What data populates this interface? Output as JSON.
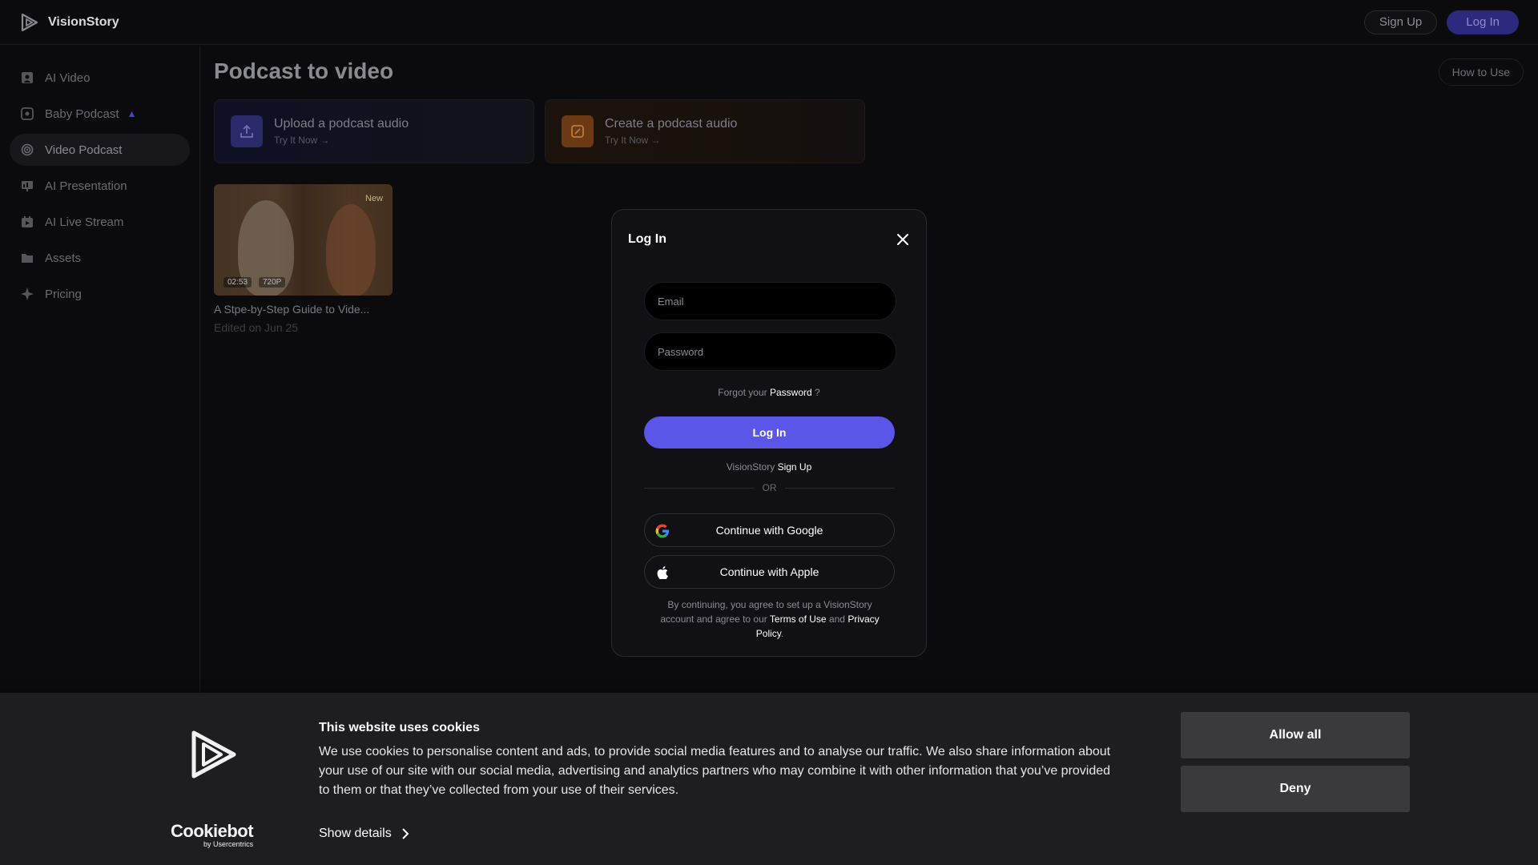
{
  "app": {
    "name": "VisionStory"
  },
  "header": {
    "signup_label": "Sign Up",
    "login_label": "Log In"
  },
  "sidebar": {
    "items": [
      {
        "label": "AI Video",
        "icon": "ai-video-icon"
      },
      {
        "label": "Baby Podcast",
        "icon": "baby-podcast-icon"
      },
      {
        "label": "Video Podcast",
        "icon": "podcast-icon"
      },
      {
        "label": "AI Presentation",
        "icon": "presentation-icon"
      },
      {
        "label": "AI Live Stream",
        "icon": "live-stream-icon"
      },
      {
        "label": "Assets",
        "icon": "folder-icon"
      },
      {
        "label": "Pricing",
        "icon": "sparkle-icon"
      }
    ]
  },
  "main": {
    "title": "Podcast to video",
    "how_to": "How to Use",
    "cards": [
      {
        "title": "Upload a podcast audio",
        "cta": "Try It Now →"
      },
      {
        "title": "Create a podcast audio",
        "cta": "Try It Now →"
      }
    ],
    "video": {
      "badge": "New",
      "duration": "02:53",
      "resolution": "720P",
      "title": "A Stpe-by-Step Guide to Vide...",
      "edited": "Edited on Jun 25"
    }
  },
  "modal": {
    "title": "Log In",
    "email_placeholder": "Email",
    "password_placeholder": "Password",
    "forgot_prefix": "Forgot your",
    "forgot_link": "Password",
    "forgot_suffix": "?",
    "login_button": "Log In",
    "signup_prefix": "VisionStory",
    "signup_link": "Sign Up",
    "or": "OR",
    "google": "Continue with Google",
    "apple": "Continue with Apple",
    "legal_text": "By continuing, you agree to set up a VisionStory account and agree to our",
    "terms": "Terms of Use",
    "and": "and",
    "privacy": "Privacy Policy",
    "period": "."
  },
  "cookie": {
    "title": "This website uses cookies",
    "text": "We use cookies to personalise content and ads, to provide social media features and to analyse our traffic. We also share information about your use of our site with our social media, advertising and analytics partners who may combine it with other information that you’ve provided to them or that they’ve collected from your use of their services.",
    "show_details": "Show details",
    "allow_all": "Allow all",
    "deny": "Deny",
    "brand": "Cookiebot",
    "brand_by": "by Usercentrics"
  },
  "colors": {
    "accent": "#5b55e8",
    "background": "#0b0b0d",
    "banner": "#1e1e20"
  }
}
